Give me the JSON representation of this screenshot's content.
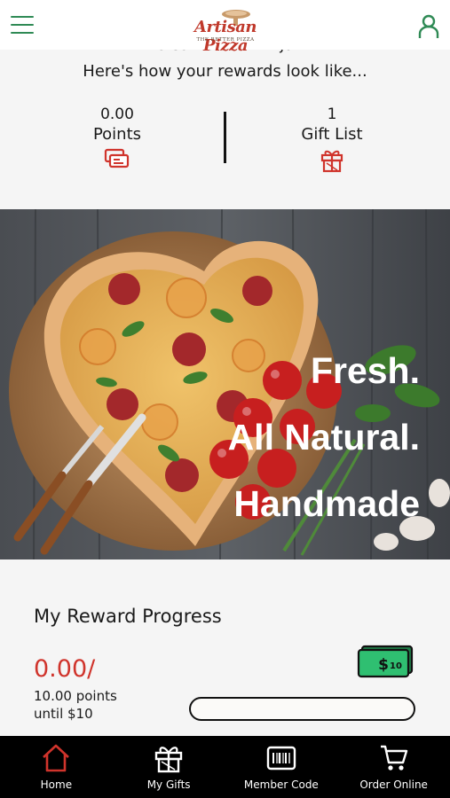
{
  "header": {
    "logo_text": "Artisan Pizza",
    "logo_tagline": "THE BETTER PIZZA",
    "menu_icon": "hamburger-menu-icon",
    "profile_icon": "user-profile-icon",
    "accent_color": "#2f8a55"
  },
  "welcome": {
    "greeting_partial": "Welcome back Arjaz!",
    "subtitle": "Here's how your rewards look like..."
  },
  "stats": {
    "points": {
      "value": "0.00",
      "label": "Points",
      "icon": "points-cards-icon"
    },
    "gifts": {
      "value": "1",
      "label": "Gift List",
      "icon": "gift-icon"
    },
    "icon_color": "#d0342c"
  },
  "banner": {
    "line1": "Fresh.",
    "line2": "All Natural.",
    "line3": "Handmade"
  },
  "reward_progress": {
    "title": "My Reward Progress",
    "value": "0.00/",
    "until_line1": "10.00 points",
    "until_line2": "until $10",
    "progress_fraction": 0.0,
    "money_icon": "ten-dollar-bill-icon",
    "money_label": "10"
  },
  "bottom_nav": [
    {
      "label": "Home",
      "icon": "home-icon",
      "active": true
    },
    {
      "label": "My Gifts",
      "icon": "gift-icon"
    },
    {
      "label": "Member Code",
      "icon": "barcode-icon"
    },
    {
      "label": "Order Online",
      "icon": "cart-icon"
    }
  ],
  "colors": {
    "brand_red": "#d0342c",
    "brand_green": "#2f8a55",
    "nav_bg": "#000000"
  }
}
